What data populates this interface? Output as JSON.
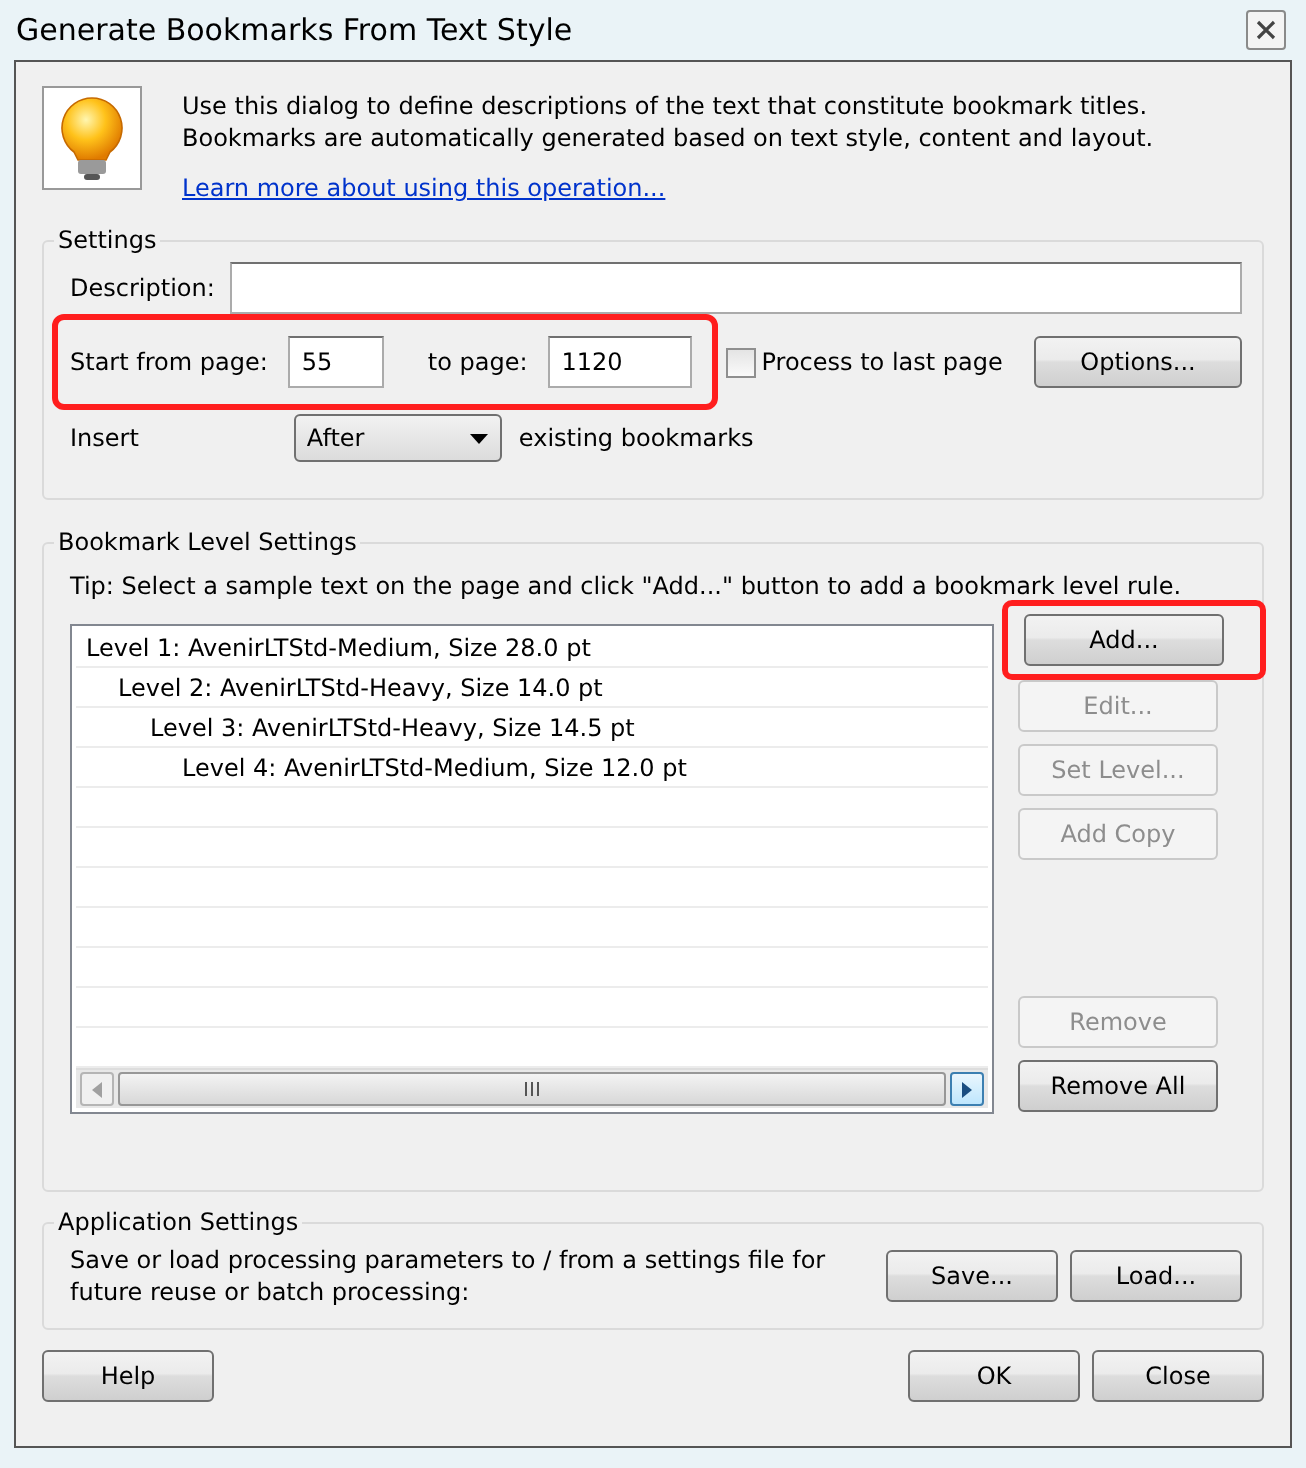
{
  "window": {
    "title": "Generate Bookmarks From Text Style"
  },
  "intro": {
    "text": "Use this dialog to define descriptions of the text that constitute bookmark titles. Bookmarks are automatically generated based on text style, content and layout.",
    "link": "Learn more about using this operation..."
  },
  "settings": {
    "legend": "Settings",
    "description_label": "Description:",
    "page_range": {
      "highlighted": true,
      "start_label": "Start from page:",
      "start_value": "55",
      "end_label": "to page:",
      "end_value": "1120"
    },
    "process_to_last": {
      "label": "Process to last page",
      "checked": false
    },
    "options_button": "Options...",
    "insert": {
      "label": "Insert",
      "value": "After",
      "suffix": "existing bookmarks"
    }
  },
  "bookmark_levels": {
    "legend": "Bookmark Level Settings",
    "tip": "Tip: Select a sample text on the page and click \"Add...\" button to add a bookmark level rule.",
    "rules": [
      {
        "label": "Level 1: AvenirLTStd-Medium, Size 28.0 pt",
        "selected": false,
        "children": [
          {
            "label": "Level 2: AvenirLTStd-Heavy, Size 14.0 pt",
            "selected": false,
            "children": [
              {
                "label": "Level 3: AvenirLTStd-Heavy, Size 14.5 pt",
                "selected": false,
                "children": [
                  {
                    "label": "Level 4: AvenirLTStd-Medium, Size 12.0 pt",
                    "selected": false
                  }
                ]
              }
            ]
          }
        ]
      }
    ],
    "buttons": [
      {
        "label": "Add...",
        "disabled": false,
        "highlighted": true
      },
      {
        "label": "Edit...",
        "disabled": true,
        "highlighted": false
      },
      {
        "label": "Set Level...",
        "disabled": true,
        "highlighted": false
      },
      {
        "label": "Add Copy",
        "disabled": true,
        "highlighted": false
      }
    ],
    "bottom_buttons": [
      {
        "label": "Remove",
        "disabled": true
      },
      {
        "label": "Remove All",
        "disabled": false
      }
    ]
  },
  "application_settings": {
    "legend": "Application Settings",
    "text": "Save or load processing parameters to / from a settings file for future reuse or batch processing:",
    "buttons": [
      "Save...",
      "Load..."
    ]
  },
  "footer": {
    "left_buttons": [
      "Help"
    ],
    "right_buttons": [
      "OK",
      "Close"
    ]
  }
}
